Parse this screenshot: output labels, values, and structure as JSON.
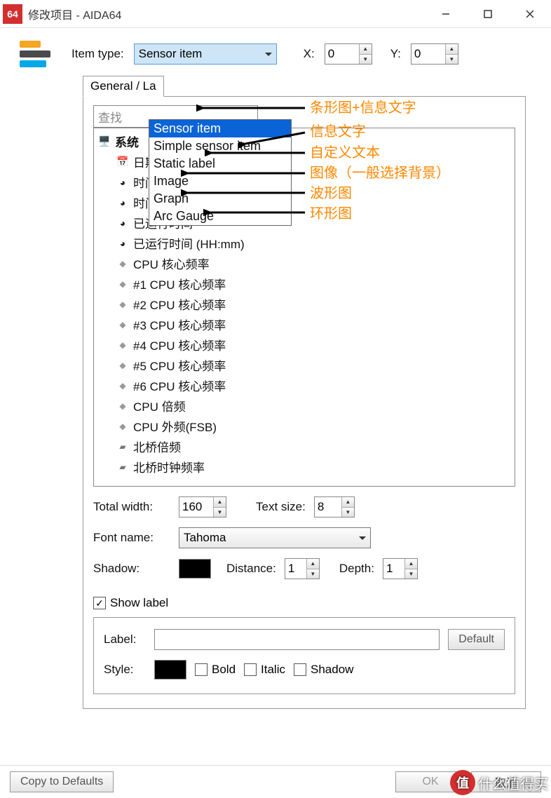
{
  "window": {
    "app_badge": "64",
    "title": "修改项目 - AIDA64"
  },
  "topbar": {
    "item_type_label": "Item type:",
    "item_type_value": "Sensor item",
    "x_input": "0",
    "y_input": "0"
  },
  "dropdown_options": [
    "Sensor item",
    "Simple sensor item",
    "Static label",
    "Image",
    "Graph",
    "Arc Gauge"
  ],
  "annotations": [
    "条形图+信息文字",
    "信息文字",
    "自定义文本",
    "图像（一般选择背景）",
    "波形图",
    "环形图"
  ],
  "tabs": {
    "general": "General / La"
  },
  "search_placeholder": "查找",
  "tree": {
    "group": "系统",
    "items": [
      {
        "icon": "cal",
        "label": "日期"
      },
      {
        "icon": "clock",
        "label": "时间"
      },
      {
        "icon": "clock",
        "label": "时间(HH:mm)"
      },
      {
        "icon": "clock",
        "label": "已运行时间"
      },
      {
        "icon": "clock",
        "label": "已运行时间 (HH:mm)"
      },
      {
        "icon": "cpu",
        "label": "CPU 核心频率"
      },
      {
        "icon": "cpu",
        "label": "#1 CPU 核心频率"
      },
      {
        "icon": "cpu",
        "label": "#2 CPU 核心频率"
      },
      {
        "icon": "cpu",
        "label": "#3 CPU 核心频率"
      },
      {
        "icon": "cpu",
        "label": "#4 CPU 核心频率"
      },
      {
        "icon": "cpu",
        "label": "#5 CPU 核心频率"
      },
      {
        "icon": "cpu",
        "label": "#6 CPU 核心频率"
      },
      {
        "icon": "cpu",
        "label": "CPU 倍频"
      },
      {
        "icon": "cpu",
        "label": "CPU 外频(FSB)"
      },
      {
        "icon": "chip",
        "label": "北桥倍频"
      },
      {
        "icon": "chip",
        "label": "北桥时钟频率"
      }
    ]
  },
  "form": {
    "total_width_label": "Total width:",
    "total_width_value": "160",
    "text_size_label": "Text size:",
    "text_size_value": "8",
    "font_name_label": "Font name:",
    "font_name_value": "Tahoma",
    "shadow_label": "Shadow:",
    "distance_label": "Distance:",
    "distance_value": "1",
    "depth_label": "Depth:",
    "depth_value": "1",
    "show_label": "Show label",
    "label_label": "Label:",
    "default_btn": "Default",
    "style_label": "Style:",
    "bold": "Bold",
    "italic": "Italic",
    "shadow_cb": "Shadow"
  },
  "footer": {
    "copy_defaults": "Copy to Defaults",
    "ok": "OK",
    "cancel": "取消"
  },
  "watermark": "什么值得买"
}
